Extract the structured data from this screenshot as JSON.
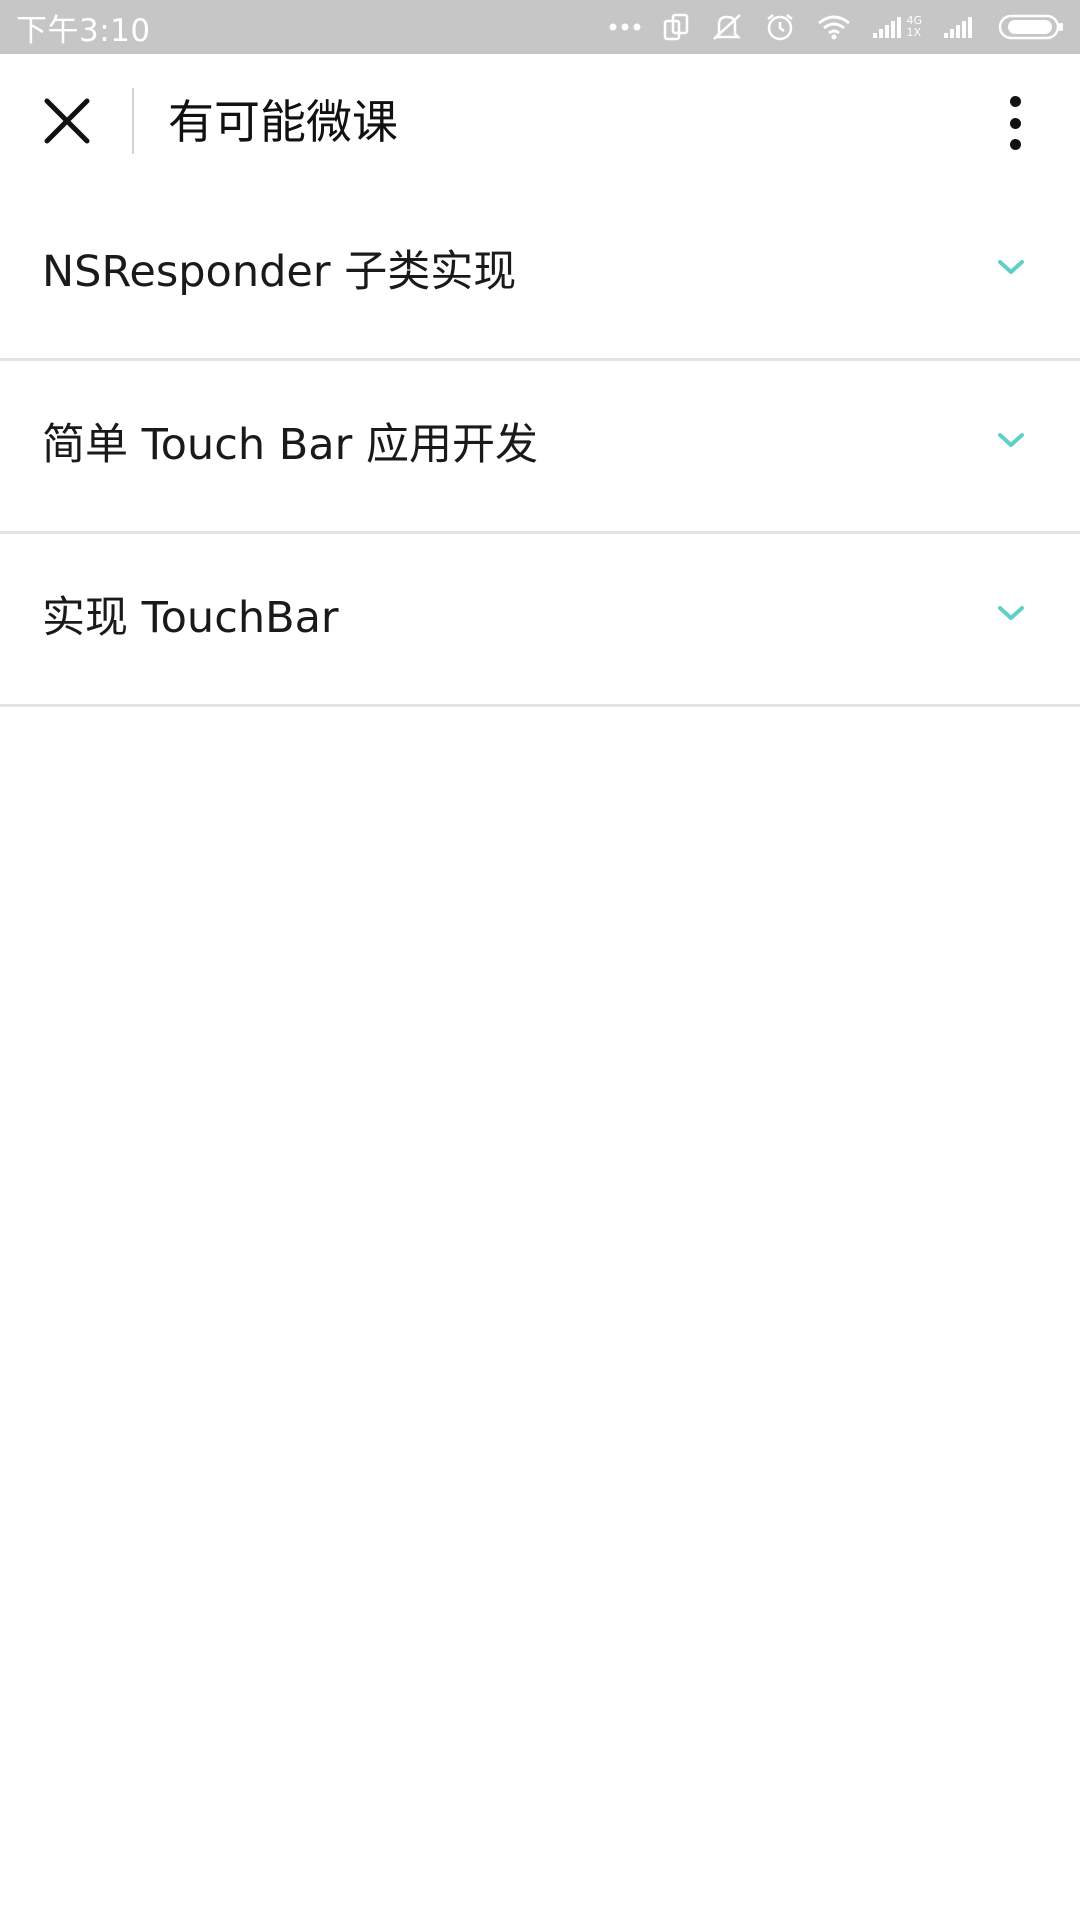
{
  "status_bar": {
    "time": "下午3:10",
    "icons": [
      "more-dots-icon",
      "screen-rotate-icon",
      "mute-icon",
      "alarm-icon",
      "wifi-icon",
      "signal-4g-icon",
      "signal-icon",
      "battery-icon"
    ],
    "network_top": "4G",
    "network_bottom": "1X"
  },
  "header": {
    "title": "有可能微课",
    "close_icon": "close-icon",
    "menu_icon": "more-vertical-icon"
  },
  "list": {
    "items": [
      {
        "label": "NSResponder 子类实现",
        "icon": "chevron-down-icon"
      },
      {
        "label": "简单 Touch Bar 应用开发",
        "icon": "chevron-down-icon"
      },
      {
        "label": "实现 TouchBar",
        "icon": "chevron-down-icon"
      }
    ]
  },
  "colors": {
    "status_bar_bg": "#c6c6c6",
    "accent": "#5fd0c8",
    "divider": "#e3e3e3",
    "text": "#1a1a1a"
  }
}
